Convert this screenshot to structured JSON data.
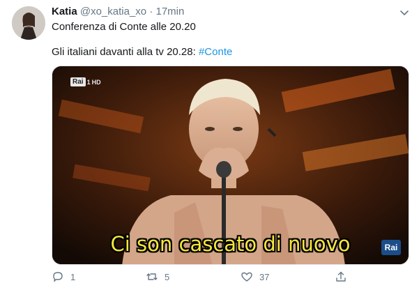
{
  "tweet": {
    "author_name": "Katia",
    "handle": "@xo_katia_xo",
    "separator": "·",
    "time": "17min",
    "text_line1": "Conferenza di Conte alle 20.20",
    "text_line2": "Gli italiani davanti alla tv 20.28:",
    "hashtag": "#Conte"
  },
  "media": {
    "caption": "Ci son cascato di nuovo",
    "logo_top_left": "Rai",
    "logo_channel": "1",
    "logo_hd": "HD",
    "logo_bottom_right": "Rai"
  },
  "actions": {
    "reply_count": "1",
    "retweet_count": "5",
    "like_count": "37",
    "icons": [
      "reply-icon",
      "retweet-icon",
      "like-icon",
      "share-icon"
    ]
  },
  "colors": {
    "hashtag": "#1b95e0",
    "meta": "#657786",
    "caption": "#f3e63d"
  }
}
